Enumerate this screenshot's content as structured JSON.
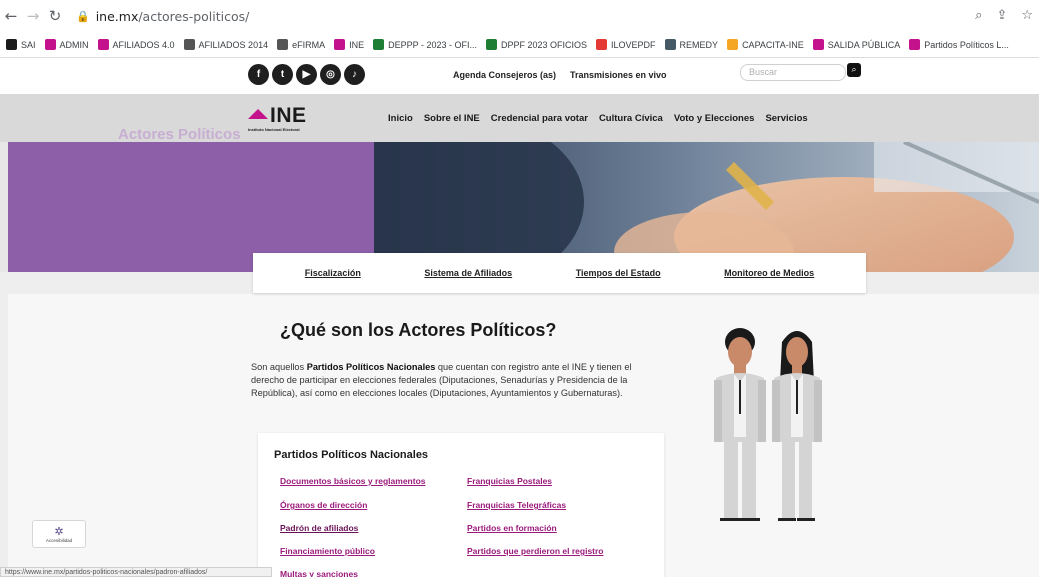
{
  "browser": {
    "url_domain": "ine.mx",
    "url_path": "/actores-politicos/",
    "bookmarks": [
      {
        "label": "SAI",
        "color": "#1a1a1a"
      },
      {
        "label": "ADMIN",
        "color": "#c4128c"
      },
      {
        "label": "AFILIADOS 4.0",
        "color": "#c4128c"
      },
      {
        "label": "AFILIADOS 2014",
        "color": "#555555"
      },
      {
        "label": "eFIRMA",
        "color": "#555555"
      },
      {
        "label": "INE",
        "color": "#c4128c"
      },
      {
        "label": "DEPPP - 2023 - OFI...",
        "color": "#1e7e34"
      },
      {
        "label": "DPPF 2023 OFICIOS",
        "color": "#1e7e34"
      },
      {
        "label": "ILOVEPDF",
        "color": "#e53935"
      },
      {
        "label": "REMEDY",
        "color": "#455a64"
      },
      {
        "label": "CAPACITA-INE",
        "color": "#f5a623"
      },
      {
        "label": "SALIDA PÚBLICA",
        "color": "#c4128c"
      },
      {
        "label": "Partidos Políticos L...",
        "color": "#c4128c"
      }
    ]
  },
  "site": {
    "social_icons": [
      "facebook-icon",
      "twitter-icon",
      "youtube-icon",
      "instagram-icon",
      "tiktok-icon"
    ],
    "top_links": [
      "Agenda Consejeros (as)",
      "Transmisiones en vivo"
    ],
    "search_placeholder": "Buscar",
    "logo_text": "INE",
    "logo_subtext": "Instituto Nacional Electoral",
    "main_nav": [
      "Inicio",
      "Sobre el INE",
      "Credencial para votar",
      "Cultura Cívica",
      "Voto y Elecciones",
      "Servicios"
    ],
    "hero_title": "Actores Políticos",
    "sub_nav": [
      "Fiscalización",
      "Sistema de Afiliados",
      "Tiempos del Estado",
      "Monitoreo de Medios"
    ],
    "heading": "¿Qué son los Actores Políticos?",
    "paragraph_pre": "Son aquellos ",
    "paragraph_bold": "Partidos Políticos Nacionales",
    "paragraph_post": " que cuentan con registro ante el INE y tienen el derecho de participar en elecciones federales (Diputaciones, Senadurías y Presidencia de la República), así como en elecciones locales (Diputaciones, Ayuntamientos y Gubernaturas).",
    "card_title": "Partidos Políticos Nacionales",
    "card_links_left": [
      "Documentos básicos y reglamentos",
      "Órganos de dirección",
      "Padrón de afiliados",
      "Financiamiento público",
      "Multas y sanciones"
    ],
    "card_links_right": [
      "Franquicias Postales",
      "Franquicias Telegráficas",
      "Partidos en formación",
      "Partidos que perdieron el registro"
    ],
    "accessibility_label": "Accesibilidad",
    "status_url": "https://www.ine.mx/partidos-politicos-nacionales/padron-afiliados/"
  }
}
